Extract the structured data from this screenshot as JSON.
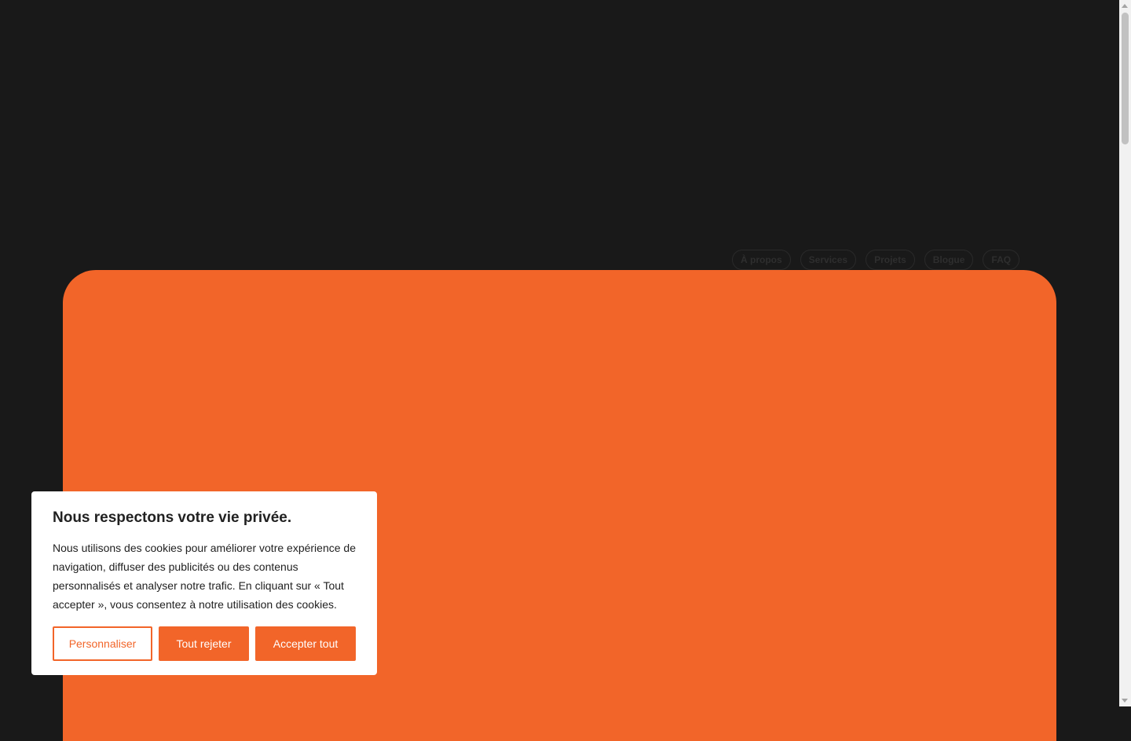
{
  "nav": {
    "items": [
      "À propos",
      "Services",
      "Projets",
      "Blogue",
      "FAQ"
    ]
  },
  "colors": {
    "background": "#191919",
    "accent": "#f26529",
    "banner_bg": "#ffffff",
    "text": "#212121"
  },
  "cookie_banner": {
    "title": "Nous respectons votre vie privée.",
    "text": "Nous utilisons des cookies pour améliorer votre expérience de navigation, diffuser des publicités ou des contenus personnalisés et analyser notre trafic. En cliquant sur « Tout accepter », vous consentez à notre utilisation des cookies.",
    "customize_label": "Personnaliser",
    "reject_label": "Tout rejeter",
    "accept_label": "Accepter tout"
  }
}
